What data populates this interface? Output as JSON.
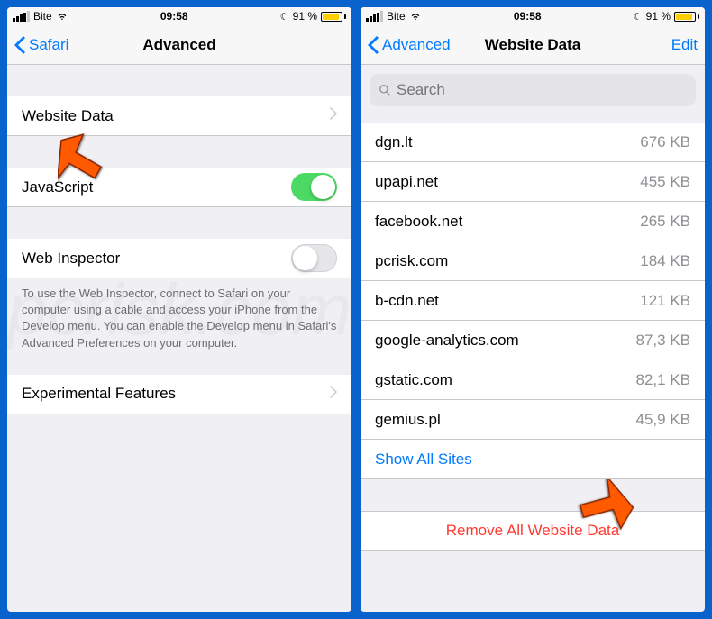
{
  "statusBar": {
    "carrier": "Bite",
    "time": "09:58",
    "batteryPercent": "91 %"
  },
  "left": {
    "backLabel": "Safari",
    "title": "Advanced",
    "rows": {
      "website_data": "Website Data",
      "javascript": "JavaScript",
      "web_inspector": "Web Inspector",
      "experimental_features": "Experimental Features"
    },
    "web_inspector_note": "To use the Web Inspector, connect to Safari on your computer using a cable and access your iPhone from the Develop menu. You can enable the Develop menu in Safari's Advanced Preferences on your computer."
  },
  "right": {
    "backLabel": "Advanced",
    "title": "Website Data",
    "editLabel": "Edit",
    "searchPlaceholder": "Search",
    "sites": [
      {
        "domain": "dgn.lt",
        "size": "676 KB"
      },
      {
        "domain": "upapi.net",
        "size": "455 KB"
      },
      {
        "domain": "facebook.net",
        "size": "265 KB"
      },
      {
        "domain": "pcrisk.com",
        "size": "184 KB"
      },
      {
        "domain": "b-cdn.net",
        "size": "121 KB"
      },
      {
        "domain": "google-analytics.com",
        "size": "87,3 KB"
      },
      {
        "domain": "gstatic.com",
        "size": "82,1 KB"
      },
      {
        "domain": "gemius.pl",
        "size": "45,9 KB"
      }
    ],
    "showAll": "Show All Sites",
    "removeAll": "Remove All Website Data"
  }
}
